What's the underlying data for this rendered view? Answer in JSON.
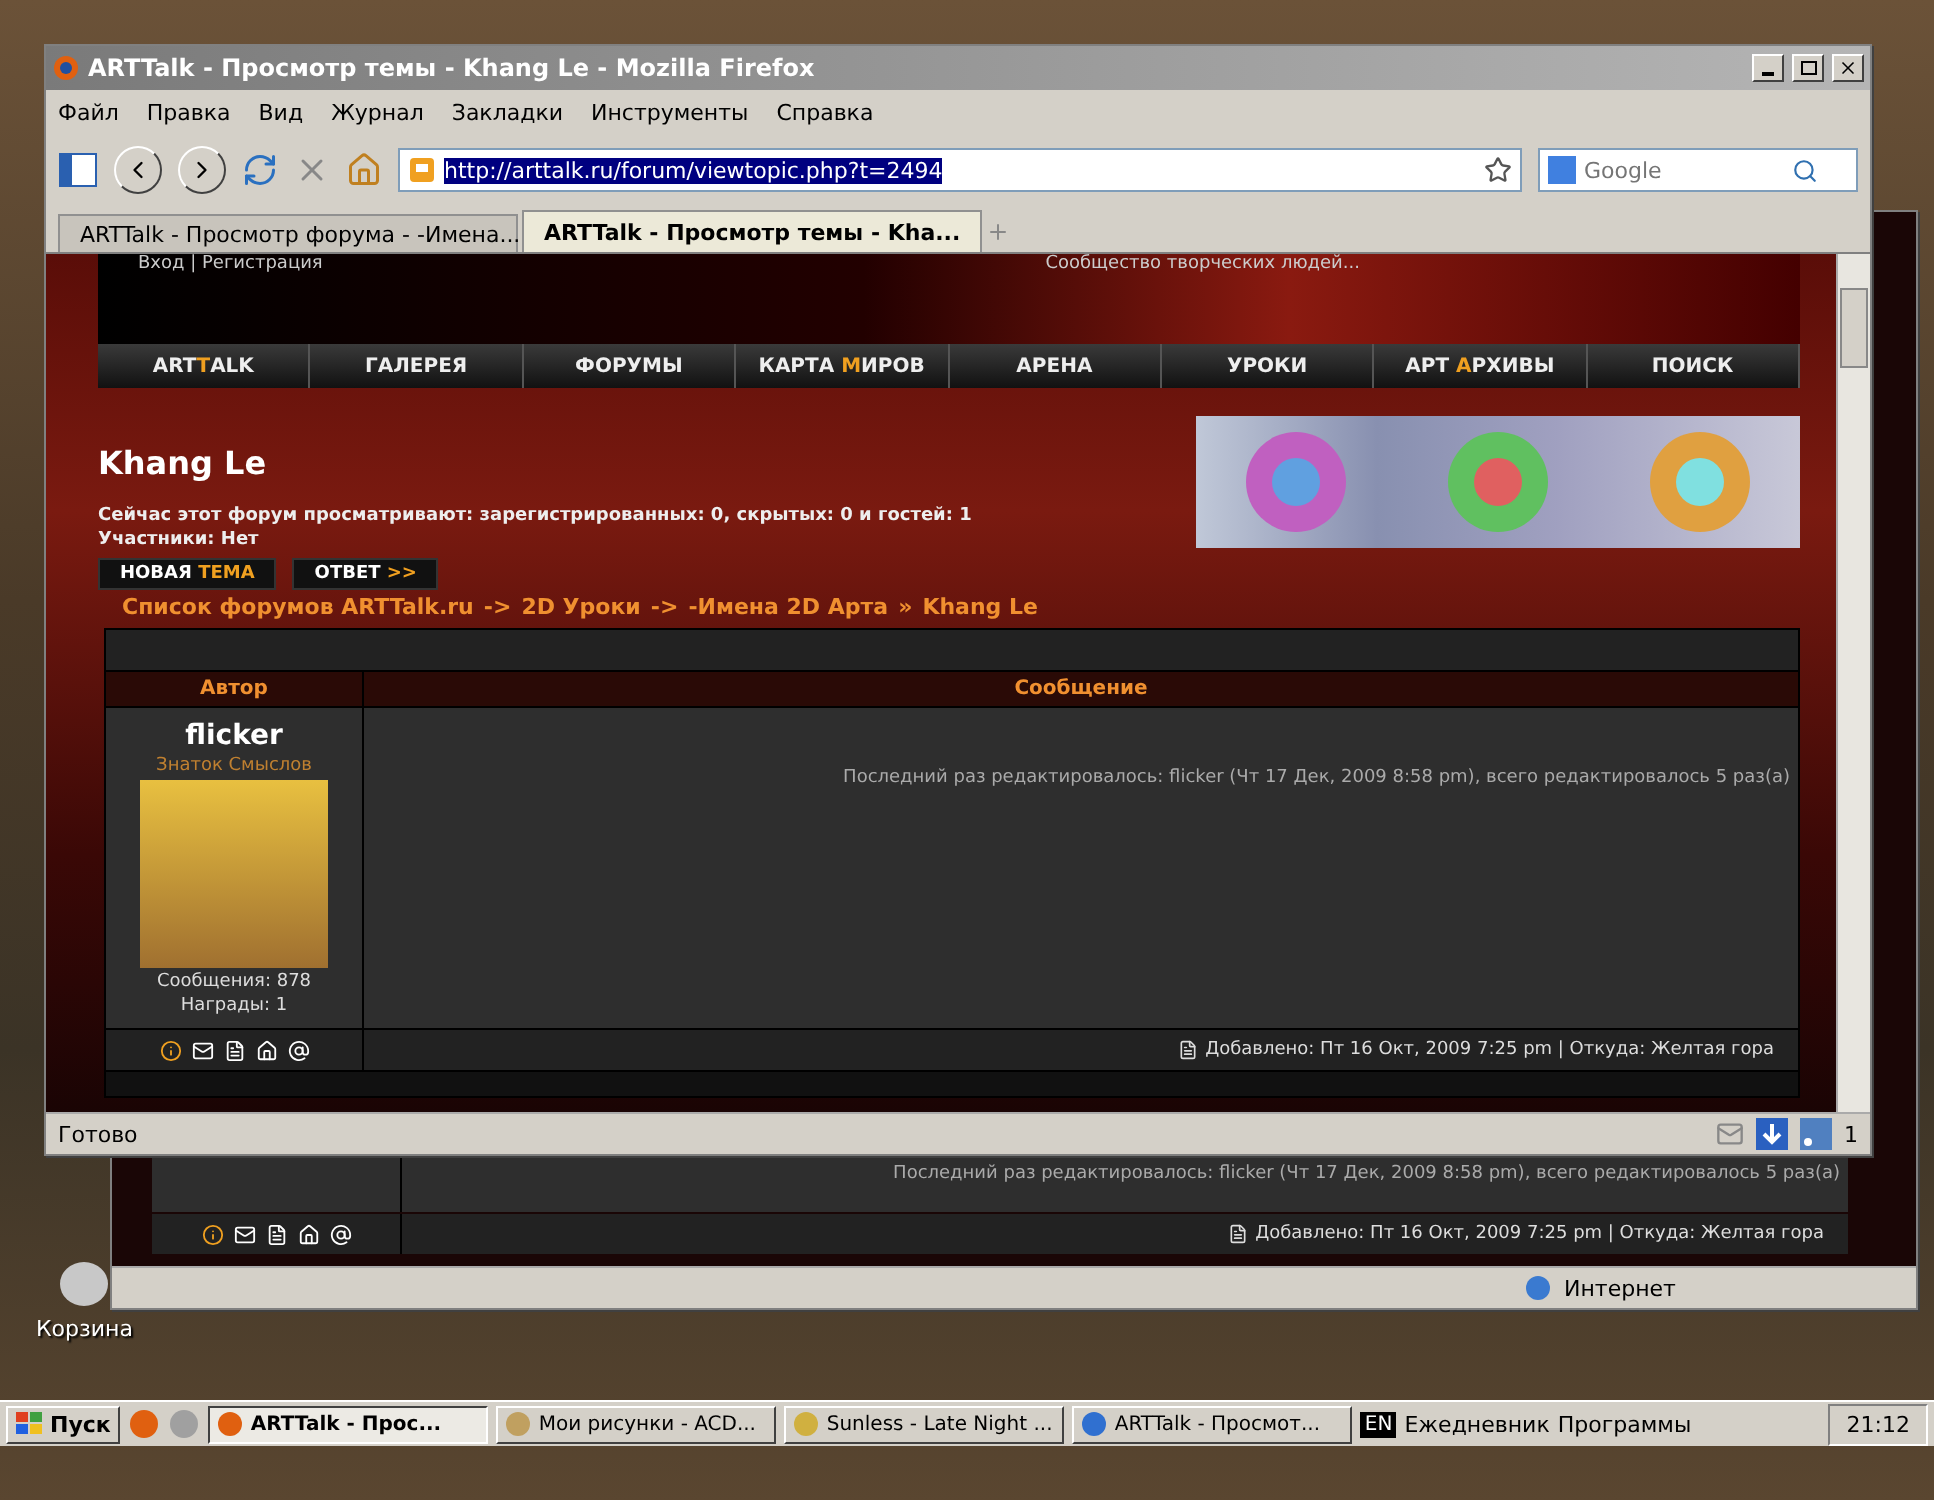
{
  "desktop": {
    "icons": [
      {
        "label": "Корзина"
      }
    ]
  },
  "back_window": {
    "edit_note": "Последний раз редактировалось: flicker (Чт 17 Дек, 2009 8:58 pm), всего редактировалось 5 раз(а)",
    "post_footer": "Добавлено: Пт 16 Окт, 2009 7:25 pm | Откуда: Желтая гора",
    "status_zone": "Интернет"
  },
  "window": {
    "title": "ARTTalk - Просмотр темы - Khang Le - Mozilla Firefox"
  },
  "menu": [
    "Файл",
    "Правка",
    "Вид",
    "Журнал",
    "Закладки",
    "Инструменты",
    "Справка"
  ],
  "address": "http://arttalk.ru/forum/viewtopic.php?t=2494",
  "search": {
    "placeholder": "Google"
  },
  "tabs": [
    {
      "label": "ARTTalk - Просмотр форума - -Имена...",
      "selected": false
    },
    {
      "label": "ARTTalk - Просмотр темы - Kha...",
      "selected": true
    }
  ],
  "page": {
    "header_links": "Вход | Регистрация",
    "tagline": "Сообщество творческих людей...",
    "nav": [
      "ART**T**ALK",
      "ГАЛЕРЕЯ",
      "ФОРУМЫ",
      "КАРТА **М**ИРОВ",
      "АРЕНА",
      "УРОКИ",
      "АРТ **А**РХИВЫ",
      "ПОИСК"
    ],
    "topic_title": "Khang Le",
    "viewers": "Сейчас этот форум просматривают: зарегистрированных: 0, скрытых: 0 и гостей: 1",
    "members": "Участники: Нет",
    "buttons": [
      "НОВАЯ **ТЕМА**",
      "ОТВЕТ **>>**"
    ],
    "breadcrumb": [
      {
        "label": "Список форумов ARTTalk.ru"
      },
      {
        "sep": "->",
        "label": "2D Уроки"
      },
      {
        "sep": "->",
        "label": "-Имена 2D Арта"
      },
      {
        "sep": "»",
        "label": "Khang Le"
      }
    ],
    "columns": [
      "Автор",
      "Сообщение"
    ],
    "post": {
      "author": "flicker",
      "rank": "Знаток Смыслов",
      "stats": [
        "Сообщения: 878",
        "Награды: 1"
      ],
      "edit_note": "Последний раз редактировалось: flicker (Чт 17 Дек, 2009 8:58 pm), всего редактировалось 5 раз(а)",
      "footer": "Добавлено: Пт 16 Окт, 2009 7:25 pm | Откуда: Желтая гора"
    }
  },
  "status_bar": {
    "text": "Готово",
    "count": "1"
  },
  "taskbar": {
    "start": "Пуск",
    "tasks": [
      {
        "label": "ARTTalk - Прос...",
        "selected": true
      },
      {
        "label": "Мои рисунки - ACD...",
        "selected": false
      },
      {
        "label": "Sunless - Late Night ...",
        "selected": false
      },
      {
        "label": "ARTTalk - Просмот...",
        "selected": false
      }
    ],
    "lang": "EN",
    "toolbars": [
      "Ежедневник",
      "Программы"
    ],
    "clock": "21:12"
  }
}
